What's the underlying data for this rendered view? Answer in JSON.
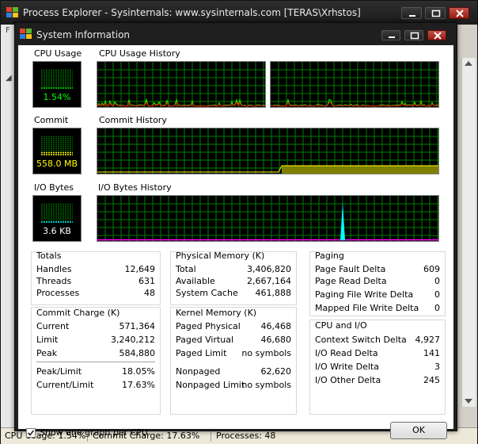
{
  "main_window": {
    "title": "Process Explorer - Sysinternals: www.sysinternals.com [TERAS\\Xrhstos]"
  },
  "dialog": {
    "title": "System Information",
    "sections": {
      "cpu_usage": "CPU Usage",
      "cpu_history": "CPU Usage History",
      "commit": "Commit",
      "commit_history": "Commit History",
      "io_bytes": "I/O Bytes",
      "io_history": "I/O Bytes History"
    },
    "meters": {
      "cpu": "1.54%",
      "commit": "558.0 MB",
      "io": "3.6  KB"
    },
    "meter_levels": {
      "cpu": 0.0154,
      "commit": 0.1763,
      "io": 0.02
    },
    "colors": {
      "grid": "#008000",
      "cpu_kernel": "#ff0000",
      "cpu_total": "#00ff00",
      "commit_fill": "#808000",
      "commit_line": "#ffff00",
      "io_line": "#00ffff",
      "io_other": "#ff00ff"
    },
    "totals": {
      "title": "Totals",
      "rows": [
        {
          "label": "Handles",
          "value": "12,649"
        },
        {
          "label": "Threads",
          "value": "631"
        },
        {
          "label": "Processes",
          "value": "48"
        }
      ]
    },
    "commit_charge": {
      "title": "Commit Charge (K)",
      "rows": [
        {
          "label": "Current",
          "value": "571,364"
        },
        {
          "label": "Limit",
          "value": "3,240,212"
        },
        {
          "label": "Peak",
          "value": "584,880"
        }
      ],
      "ratios": [
        {
          "label": "Peak/Limit",
          "value": "18.05%"
        },
        {
          "label": "Current/Limit",
          "value": "17.63%"
        }
      ]
    },
    "physical_memory": {
      "title": "Physical Memory (K)",
      "rows": [
        {
          "label": "Total",
          "value": "3,406,820"
        },
        {
          "label": "Available",
          "value": "2,667,164"
        },
        {
          "label": "System Cache",
          "value": "461,888"
        }
      ]
    },
    "kernel_memory": {
      "title": "Kernel Memory (K)",
      "rows": [
        {
          "label": "Paged Physical",
          "value": "46,468"
        },
        {
          "label": "Paged Virtual",
          "value": "46,680"
        },
        {
          "label": "Paged Limit",
          "value": "no symbols"
        }
      ],
      "rows2": [
        {
          "label": "Nonpaged",
          "value": "62,620"
        },
        {
          "label": "Nonpaged Limit",
          "value": "no symbols"
        }
      ]
    },
    "paging": {
      "title": "Paging",
      "rows": [
        {
          "label": "Page Fault Delta",
          "value": "609"
        },
        {
          "label": "Page Read Delta",
          "value": "0"
        },
        {
          "label": "Paging File Write Delta",
          "value": "0"
        },
        {
          "label": "Mapped File Write Delta",
          "value": "0"
        }
      ]
    },
    "cpu_io": {
      "title": "CPU and I/O",
      "rows": [
        {
          "label": "Context Switch Delta",
          "value": "4,927"
        },
        {
          "label": "I/O Read Delta",
          "value": "141"
        },
        {
          "label": "I/O Write Delta",
          "value": "3"
        },
        {
          "label": "I/O Other Delta",
          "value": "245"
        }
      ]
    },
    "checkbox": {
      "label": "Show one graph per CPU",
      "checked": true
    },
    "ok_label": "OK"
  },
  "statusbar": {
    "cpu": "CPU Usage: 1.54%",
    "commit": "Commit Charge: 17.63%",
    "processes": "Processes: 48"
  },
  "icons": [
    "windows-logo-icon",
    "minimize-icon",
    "maximize-icon",
    "close-icon",
    "checkmark-icon"
  ]
}
